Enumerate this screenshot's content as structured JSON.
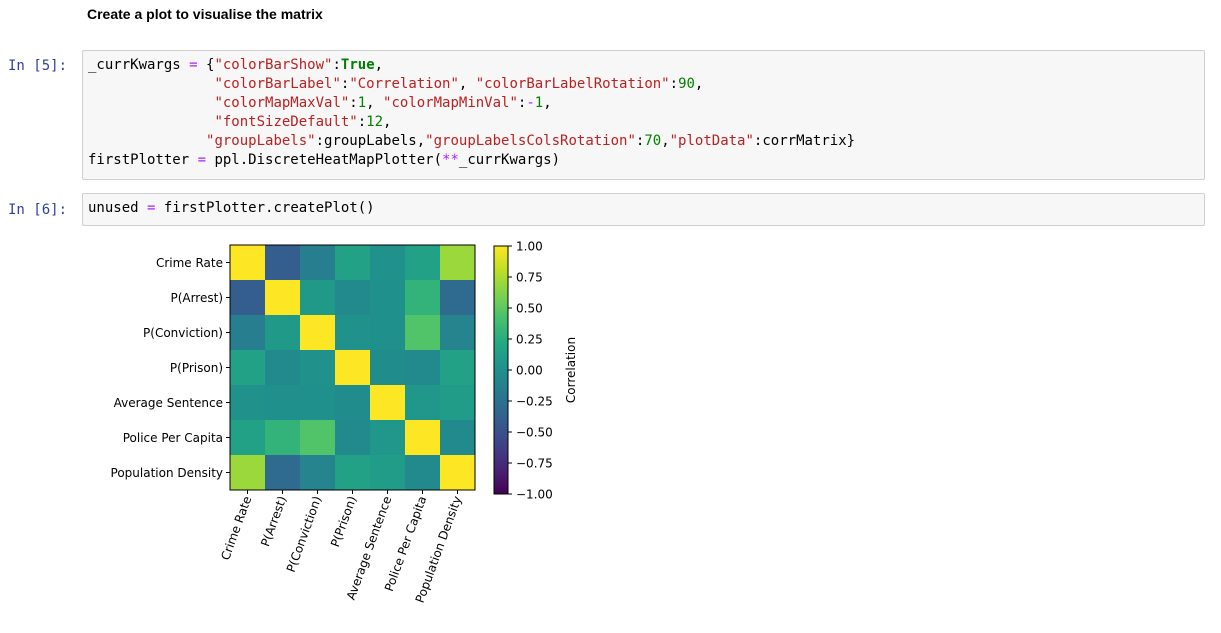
{
  "markdown": {
    "heading": "Create a plot to visualise the matrix"
  },
  "cells": [
    {
      "prompt": "In [5]:",
      "lines": [
        [
          [
            "tk-var",
            "_currKwargs "
          ],
          [
            "tk-op",
            "="
          ],
          [
            "tk-var",
            " {"
          ],
          [
            "tk-str",
            "\"colorBarShow\""
          ],
          [
            "tk-var",
            ":"
          ],
          [
            "tk-kw",
            "True"
          ],
          [
            "tk-var",
            ","
          ]
        ],
        [
          [
            "tk-var",
            "               "
          ],
          [
            "tk-str",
            "\"colorBarLabel\""
          ],
          [
            "tk-var",
            ":"
          ],
          [
            "tk-str",
            "\"Correlation\""
          ],
          [
            "tk-var",
            ", "
          ],
          [
            "tk-str",
            "\"colorBarLabelRotation\""
          ],
          [
            "tk-var",
            ":"
          ],
          [
            "tk-num",
            "90"
          ],
          [
            "tk-var",
            ","
          ]
        ],
        [
          [
            "tk-var",
            "               "
          ],
          [
            "tk-str",
            "\"colorMapMaxVal\""
          ],
          [
            "tk-var",
            ":"
          ],
          [
            "tk-num",
            "1"
          ],
          [
            "tk-var",
            ", "
          ],
          [
            "tk-str",
            "\"colorMapMinVal\""
          ],
          [
            "tk-var",
            ":"
          ],
          [
            "tk-op",
            "-"
          ],
          [
            "tk-num",
            "1"
          ],
          [
            "tk-var",
            ","
          ]
        ],
        [
          [
            "tk-var",
            "               "
          ],
          [
            "tk-str",
            "\"fontSizeDefault\""
          ],
          [
            "tk-var",
            ":"
          ],
          [
            "tk-num",
            "12"
          ],
          [
            "tk-var",
            ","
          ]
        ],
        [
          [
            "tk-var",
            "              "
          ],
          [
            "tk-str",
            "\"groupLabels\""
          ],
          [
            "tk-var",
            ":groupLabels,"
          ],
          [
            "tk-str",
            "\"groupLabelsColsRotation\""
          ],
          [
            "tk-var",
            ":"
          ],
          [
            "tk-num",
            "70"
          ],
          [
            "tk-var",
            ","
          ],
          [
            "tk-str",
            "\"plotData\""
          ],
          [
            "tk-var",
            ":corrMatrix}"
          ]
        ],
        [
          [
            "tk-var",
            "firstPlotter "
          ],
          [
            "tk-op",
            "="
          ],
          [
            "tk-var",
            " ppl.DiscreteHeatMapPlotter("
          ],
          [
            "tk-op",
            "**"
          ],
          [
            "tk-var",
            "_currKwargs)"
          ]
        ]
      ]
    },
    {
      "prompt": "In [6]:",
      "lines": [
        [
          [
            "tk-var",
            "unused "
          ],
          [
            "tk-op",
            "="
          ],
          [
            "tk-var",
            " firstPlotter.createPlot()"
          ]
        ]
      ]
    }
  ],
  "chart_data": {
    "type": "heatmap",
    "row_labels": [
      "Crime Rate",
      "P(Arrest)",
      "P(Conviction)",
      "P(Prison)",
      "Average Sentence",
      "Police Per Capita",
      "Population Density"
    ],
    "col_labels": [
      "Crime Rate",
      "P(Arrest)",
      "P(Conviction)",
      "P(Prison)",
      "Average Sentence",
      "Police Per Capita",
      "Population Density"
    ],
    "values": [
      [
        1.0,
        -0.4,
        -0.15,
        0.15,
        0.02,
        0.15,
        0.7
      ],
      [
        -0.4,
        1.0,
        0.08,
        -0.05,
        0.0,
        0.3,
        -0.3
      ],
      [
        -0.15,
        0.08,
        1.0,
        0.02,
        0.0,
        0.45,
        -0.1
      ],
      [
        0.15,
        -0.05,
        0.02,
        1.0,
        -0.03,
        -0.05,
        0.15
      ],
      [
        0.02,
        0.0,
        0.0,
        -0.03,
        1.0,
        0.05,
        0.1
      ],
      [
        0.15,
        0.3,
        0.45,
        -0.05,
        0.05,
        1.0,
        -0.05
      ],
      [
        0.7,
        -0.3,
        -0.1,
        0.15,
        0.1,
        -0.05,
        1.0
      ]
    ],
    "colorbar": {
      "label": "Correlation",
      "min": -1,
      "max": 1,
      "ticks": [
        "1.00",
        "0.75",
        "0.50",
        "0.25",
        "0.00",
        "−0.25",
        "−0.50",
        "−0.75",
        "−1.00"
      ],
      "tick_values": [
        1,
        0.75,
        0.5,
        0.25,
        0,
        -0.25,
        -0.5,
        -0.75,
        -1
      ]
    },
    "colormap": "viridis",
    "x_label_rotation": 70
  }
}
